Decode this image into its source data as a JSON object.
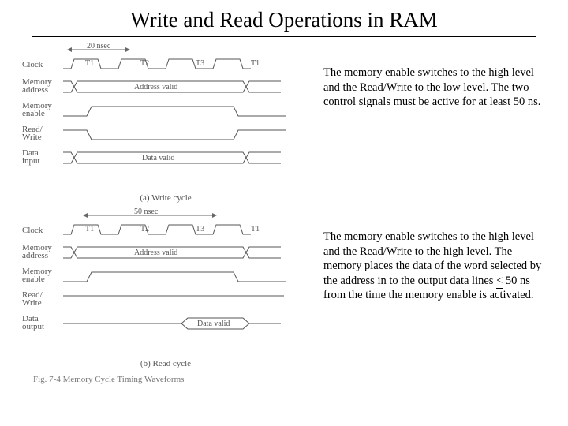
{
  "title": "Write and Read Operations in RAM",
  "timing_marker_a": "20 nsec",
  "timing_marker_b": "50 nsec",
  "clock_labels": {
    "t1": "T1",
    "t2": "T2",
    "t3": "T3",
    "t1b": "T1"
  },
  "signals_a": {
    "clock": "Clock",
    "mem_addr": "Memory\naddress",
    "mem_en": "Memory\nenable",
    "rw": "Read/\nWrite",
    "data": "Data\ninput"
  },
  "signals_b": {
    "clock": "Clock",
    "mem_addr": "Memory\naddress",
    "mem_en": "Memory\nenable",
    "rw": "Read/\nWrite",
    "data": "Data\noutput"
  },
  "bus_labels": {
    "addr_valid": "Address valid",
    "data_valid": "Data valid"
  },
  "caption_a": "(a) Write cycle",
  "caption_b": "(b) Read cycle",
  "figure_caption": "Fig. 7-4  Memory Cycle Timing Waveforms",
  "desc_a": "The memory enable switches to the high level and the Read/Write to the low level. The two control signals must be active for at least 50 ns.",
  "desc_b_pre": "The memory enable switches to the high level and the Read/Write to the high level. The memory places the data of the word selected by the address in to the output data lines ",
  "desc_b_rel": "<",
  "desc_b_post": " 50 ns from the time the memory enable is activated."
}
